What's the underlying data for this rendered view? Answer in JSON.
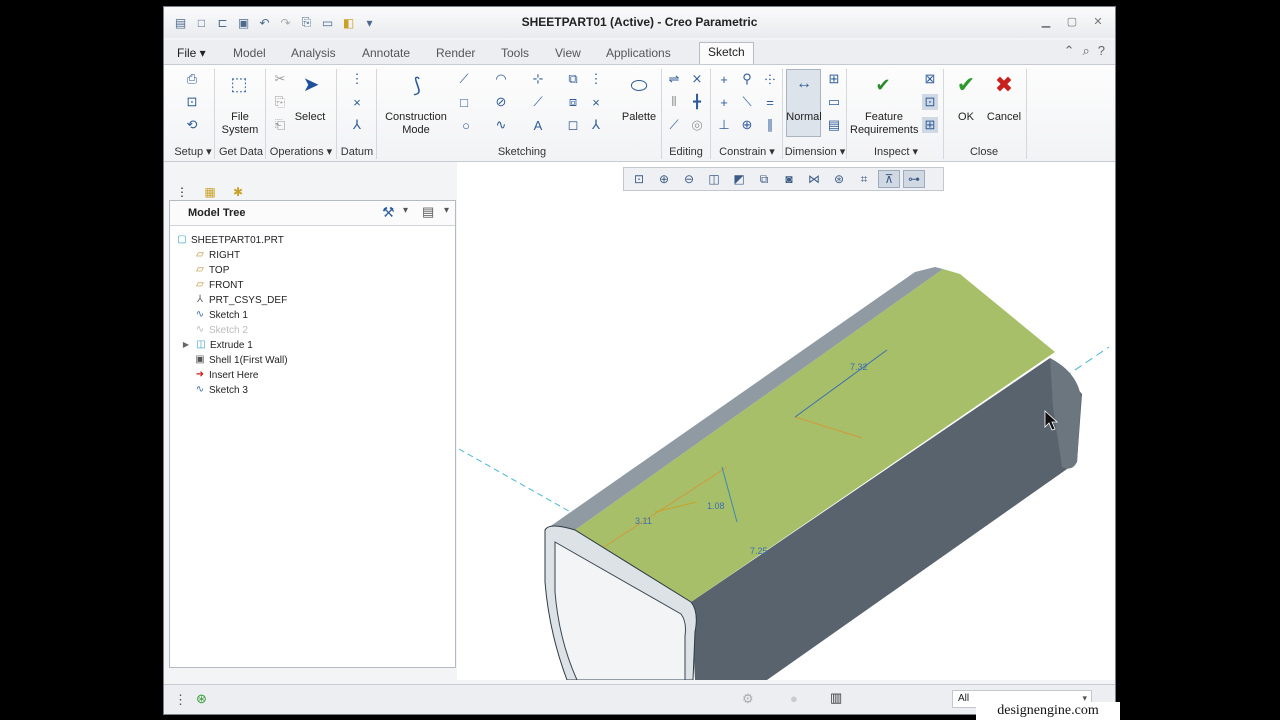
{
  "window": {
    "title": "SHEETPART01 (Active) - Creo Parametric"
  },
  "tabs": [
    {
      "label": "File ▾"
    },
    {
      "label": "Model"
    },
    {
      "label": "Analysis"
    },
    {
      "label": "Annotate"
    },
    {
      "label": "Render"
    },
    {
      "label": "Tools"
    },
    {
      "label": "View"
    },
    {
      "label": "Applications"
    },
    {
      "label": "Sketch"
    }
  ],
  "ribbon": {
    "file_system": "File\nSystem",
    "select": "Select",
    "construction_mode": "Construction\nMode",
    "palette": "Palette",
    "normal": "Normal",
    "feature_requirements": "Feature\nRequirements",
    "ok": "OK",
    "cancel": "Cancel",
    "groups": {
      "setup": "Setup ▾",
      "get_data": "Get Data",
      "operations": "Operations ▾",
      "datum": "Datum",
      "sketching": "Sketching",
      "editing": "Editing",
      "constrain": "Constrain ▾",
      "dimension": "Dimension ▾",
      "inspect": "Inspect ▾",
      "close": "Close"
    }
  },
  "model_tree": {
    "title": "Model Tree",
    "items": [
      {
        "label": "SHEETPART01.PRT",
        "icon": "part-icon"
      },
      {
        "label": "RIGHT",
        "icon": "datum-plane-icon"
      },
      {
        "label": "TOP",
        "icon": "datum-plane-icon"
      },
      {
        "label": "FRONT",
        "icon": "datum-plane-icon"
      },
      {
        "label": "PRT_CSYS_DEF",
        "icon": "csys-icon"
      },
      {
        "label": "Sketch 1",
        "icon": "sketch-icon"
      },
      {
        "label": "Sketch 2",
        "icon": "sketch-icon"
      },
      {
        "label": "Extrude 1",
        "icon": "extrude-icon"
      },
      {
        "label": "Shell 1(First Wall)",
        "icon": "shell-icon"
      },
      {
        "label": "Insert Here",
        "icon": "insert-arrow-icon"
      },
      {
        "label": "Sketch 3",
        "icon": "sketch-icon"
      }
    ]
  },
  "sketch_dims": {
    "d1": "7.32",
    "d2": "3.11",
    "d3": "1.08",
    "d4": "7.25"
  },
  "status": {
    "filter": "All"
  },
  "watermark": "designengine.com",
  "colors": {
    "face_green": "#a8bf6a",
    "body_gray": "#5f6b75",
    "accent": "#2e5c9a"
  }
}
